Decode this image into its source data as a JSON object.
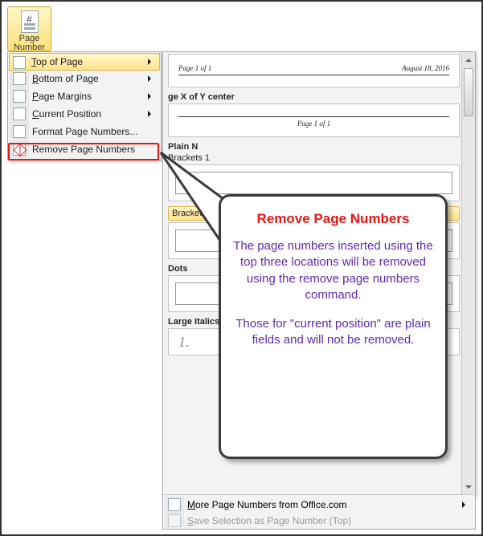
{
  "ribbon": {
    "page_number": "Page\nNumber"
  },
  "menu": {
    "top_of_page": "Top of Page",
    "bottom_of_page": "Bottom of Page",
    "page_margins": "Page Margins",
    "current_position": "Current Position",
    "format_page_numbers": "Format Page Numbers...",
    "remove_page_numbers": "Remove Page Numbers"
  },
  "gallery": {
    "previews": {
      "page_x_of_y": "Page 1 of 1",
      "date": "August 18, 2016"
    },
    "categories": {
      "page_x_of_y_center": "ge X of Y center",
      "plain": "Plain Number",
      "brackets1": "Brackets 1",
      "brackets2": "Brackets 2",
      "dots": "Dots",
      "large_italics": "Large Italics 1"
    },
    "large_italics_sample": "1."
  },
  "footer": {
    "more": "More Page Numbers from Office.com",
    "save_sel": "Save Selection as Page Number (Top)"
  },
  "callout": {
    "title": "Remove Page Numbers",
    "p1": "The page numbers inserted using the top three locations will be removed using the remove page numbers command.",
    "p2": "Those for \"current position\" are plain fields and will not be removed."
  }
}
